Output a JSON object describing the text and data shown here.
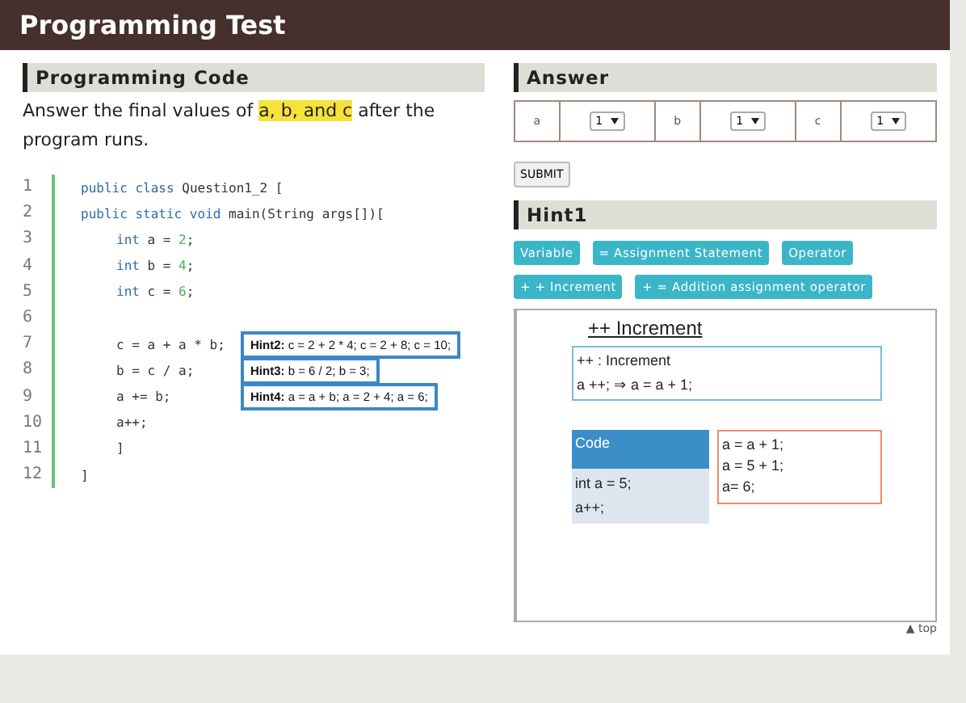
{
  "header": {
    "title": "Programming Test"
  },
  "code_section": {
    "heading": "Programming Code",
    "instruction": "Answer the final values of ",
    "highlight": "a, b, and c",
    "instruction_end": " after the program runs.",
    "lines": [
      {
        "number": "1",
        "kind": "outer",
        "tokens": [
          {
            "text": "public class ",
            "kind": "keyword"
          },
          {
            "text": "Question1_2 [",
            "kind": "plain"
          }
        ]
      },
      {
        "number": "2",
        "kind": "outer",
        "tokens": [
          {
            "text": "public static void ",
            "kind": "keyword"
          },
          {
            "text": "main(String args[])[",
            "kind": "plain"
          }
        ]
      },
      {
        "number": "3",
        "kind": "inner",
        "tokens": [
          {
            "text": "int ",
            "kind": "keyword"
          },
          {
            "text": "a = ",
            "kind": "plain"
          },
          {
            "text": "2",
            "kind": "number"
          },
          {
            "text": ";",
            "kind": "plain"
          }
        ]
      },
      {
        "number": "4",
        "kind": "inner",
        "tokens": [
          {
            "text": "int ",
            "kind": "keyword"
          },
          {
            "text": "b = ",
            "kind": "plain"
          },
          {
            "text": "4",
            "kind": "number"
          },
          {
            "text": ";",
            "kind": "plain"
          }
        ]
      },
      {
        "number": "5",
        "kind": "inner",
        "tokens": [
          {
            "text": "int ",
            "kind": "keyword"
          },
          {
            "text": "c = ",
            "kind": "plain"
          },
          {
            "text": "6",
            "kind": "number"
          },
          {
            "text": ";",
            "kind": "plain"
          }
        ]
      },
      {
        "number": "6",
        "kind": "outer"
      },
      {
        "number": "7",
        "kind": "inner",
        "tokens": [
          {
            "text": "c = a + a * b;",
            "kind": "plain"
          }
        ],
        "hint": "**Hint2:** c = 2 + 2 * 4; c = 2 + 8; c = 10;"
      },
      {
        "number": "8",
        "kind": "inner",
        "tokens": [
          {
            "text": "b = c / a;",
            "kind": "plain"
          }
        ],
        "hint": "**Hint3:** b = 6 / 2; b = 3;"
      },
      {
        "number": "9",
        "kind": "inner",
        "tokens": [
          {
            "text": "a += b;",
            "kind": "plain"
          }
        ],
        "hint": "**Hint4:** a = a + b; a = 2 + 4; a = 6;"
      },
      {
        "number": "10",
        "kind": "inner",
        "tokens": [
          {
            "text": "a++;",
            "kind": "plain"
          }
        ]
      },
      {
        "number": "11",
        "kind": "inner",
        "tokens": [
          {
            "text": "]",
            "kind": "plain"
          }
        ]
      },
      {
        "number": "12",
        "kind": "outer",
        "tokens": [
          {
            "text": "]",
            "kind": "plain"
          }
        ]
      }
    ]
  },
  "answer": {
    "heading": "Answer",
    "fields": [
      {
        "label": "a",
        "value": "1"
      },
      {
        "label": "b",
        "value": "1"
      },
      {
        "label": "c",
        "value": "1"
      }
    ],
    "submit": "SUBMIT"
  },
  "hint1": {
    "heading": "Hint1",
    "tags": [
      "Variable",
      "= Assignment Statement",
      "Operator",
      "+ + Increment",
      "+ =  Addition assignment operator"
    ],
    "panel": {
      "title": "++ Increment",
      "definition": [
        "++ : Increment",
        "a ++;  ⇒  a = a + 1;"
      ],
      "code_header": "Code",
      "code_lines": [
        "int a = 5;",
        "a++;"
      ],
      "steps": [
        "a = a + 1;",
        "a = 5 + 1;",
        "a= 6;"
      ]
    }
  },
  "footer": {
    "top_link": "▲ top"
  }
}
